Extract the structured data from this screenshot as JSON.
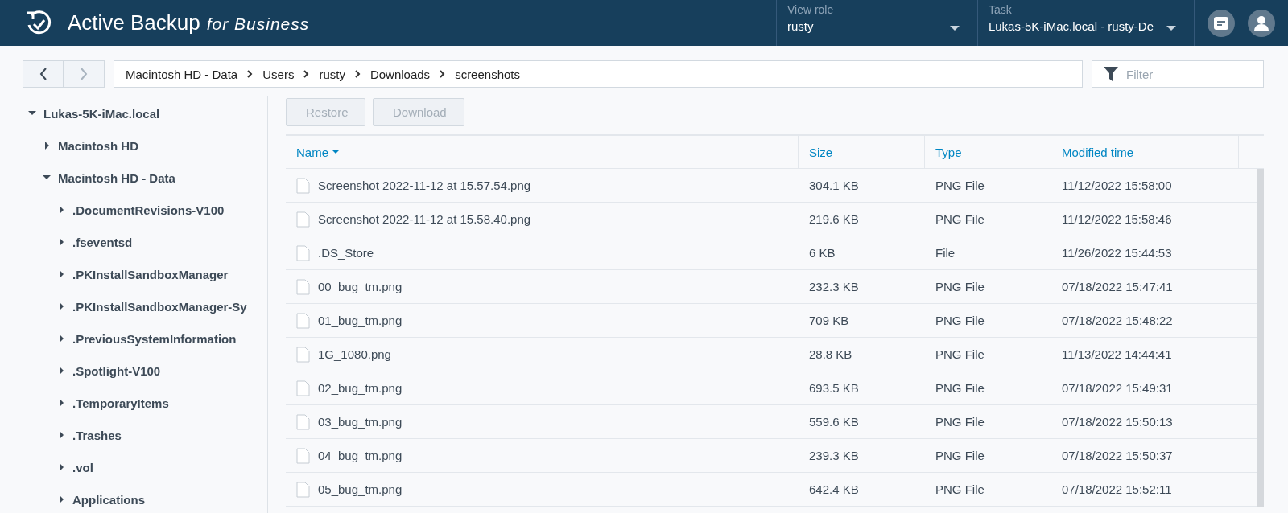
{
  "header": {
    "app_name": "Active Backup",
    "app_suffix": "for Business",
    "dropdowns": [
      {
        "label": "View role",
        "value": "rusty"
      },
      {
        "label": "Task",
        "value": "Lukas-5K-iMac.local - rusty-De"
      }
    ]
  },
  "toolbar": {
    "back": {
      "disabled": false
    },
    "forward": {
      "disabled": true
    },
    "breadcrumb": [
      "Macintosh HD - Data",
      "Users",
      "rusty",
      "Downloads",
      "screenshots"
    ],
    "filter": {
      "placeholder": "Filter"
    }
  },
  "tree": [
    {
      "label": "Lukas-5K-iMac.local",
      "expanded": true,
      "children": [
        {
          "label": "Macintosh HD",
          "expanded": false
        },
        {
          "label": "Macintosh HD - Data",
          "expanded": true,
          "children": [
            {
              "label": ".DocumentRevisions-V100",
              "expanded": false
            },
            {
              "label": ".fseventsd",
              "expanded": false
            },
            {
              "label": ".PKInstallSandboxManager",
              "expanded": false
            },
            {
              "label": ".PKInstallSandboxManager-Sy",
              "expanded": false
            },
            {
              "label": ".PreviousSystemInformation",
              "expanded": false
            },
            {
              "label": ".Spotlight-V100",
              "expanded": false
            },
            {
              "label": ".TemporaryItems",
              "expanded": false
            },
            {
              "label": ".Trashes",
              "expanded": false
            },
            {
              "label": ".vol",
              "expanded": false
            },
            {
              "label": "Applications",
              "expanded": false
            }
          ]
        }
      ]
    }
  ],
  "actions": [
    {
      "label": "Restore",
      "disabled": true
    },
    {
      "label": "Download",
      "disabled": true
    }
  ],
  "table": {
    "columns": [
      {
        "label": "Name",
        "sorted": true
      },
      {
        "label": "Size",
        "sorted": false
      },
      {
        "label": "Type",
        "sorted": false
      },
      {
        "label": "Modified time",
        "sorted": false
      }
    ],
    "rows": [
      [
        "Screenshot 2022-11-12 at 15.57.54.png",
        "304.1 KB",
        "PNG File",
        "11/12/2022 15:58:00"
      ],
      [
        "Screenshot 2022-11-12 at 15.58.40.png",
        "219.6 KB",
        "PNG File",
        "11/12/2022 15:58:46"
      ],
      [
        ".DS_Store",
        "6 KB",
        "File",
        "11/26/2022 15:44:53"
      ],
      [
        "00_bug_tm.png",
        "232.3 KB",
        "PNG File",
        "07/18/2022 15:47:41"
      ],
      [
        "01_bug_tm.png",
        "709 KB",
        "PNG File",
        "07/18/2022 15:48:22"
      ],
      [
        "1G_1080.png",
        "28.8 KB",
        "PNG File",
        "11/13/2022 14:44:41"
      ],
      [
        "02_bug_tm.png",
        "693.5 KB",
        "PNG File",
        "07/18/2022 15:49:31"
      ],
      [
        "03_bug_tm.png",
        "559.6 KB",
        "PNG File",
        "07/18/2022 15:50:13"
      ],
      [
        "04_bug_tm.png",
        "239.3 KB",
        "PNG File",
        "07/18/2022 15:50:37"
      ],
      [
        "05_bug_tm.png",
        "642.4 KB",
        "PNG File",
        "07/18/2022 15:52:11"
      ]
    ]
  }
}
